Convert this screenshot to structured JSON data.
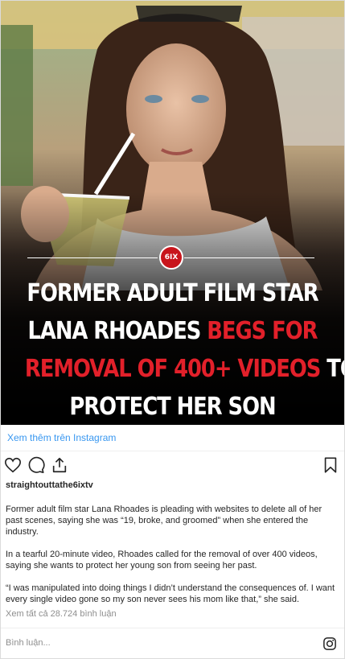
{
  "post": {
    "headline": {
      "line1": "FORMER ADULT FILM STAR",
      "line2_white": "LANA RHOADES ",
      "line2_red": "BEGS FOR",
      "line3_red": "REMOVAL OF 400+ VIDEOS",
      "line3_white": " TO",
      "line4": "PROTECT HER SON"
    },
    "badge_text": "6IX",
    "view_more_label": "Xem thêm trên Instagram",
    "username": "straightouttathe6ixtv",
    "caption": [
      "Former adult film star Lana Rhoades is pleading with websites to delete all of her past scenes, saying she was “19, broke, and groomed” when she entered the industry.",
      "In a tearful 20-minute video, Rhoades called for the removal of over 400 videos, saying she wants to protect her young son from seeing her past.",
      "“I was manipulated into doing things I didn’t understand the consequences of. I want every single video gone so my son never sees his mom like that,” she said."
    ],
    "view_comments_label": "Xem tất cả 28.724 bình luận",
    "comment_placeholder": "Bình luận...",
    "colors": {
      "accent_red": "#e2202a",
      "link_blue": "#3897f0",
      "muted": "#8e8e8e"
    },
    "icons": [
      "heart-icon",
      "comment-icon",
      "share-icon",
      "bookmark-icon",
      "instagram-icon"
    ]
  }
}
